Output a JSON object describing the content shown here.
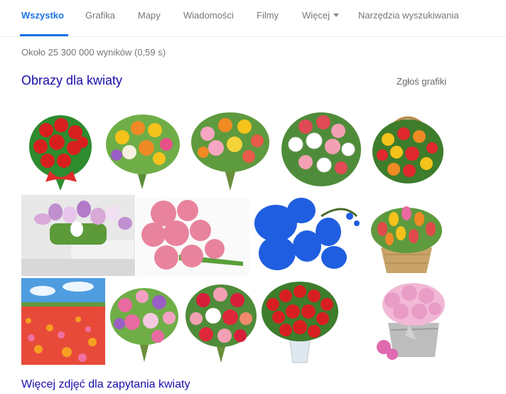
{
  "tabs": [
    {
      "label": "Wszystko",
      "active": true
    },
    {
      "label": "Grafika"
    },
    {
      "label": "Mapy"
    },
    {
      "label": "Wiadomości"
    },
    {
      "label": "Filmy"
    },
    {
      "label": "Więcej",
      "dropdown": true
    },
    {
      "label": "Narzędzia wyszukiwania"
    }
  ],
  "results": {
    "stats": "Około 25 300 000 wyników (0,59 s)",
    "images_heading": "Obrazy dla kwiaty",
    "report_label": "Zgłoś grafiki",
    "more_images_link": "Więcej zdjęć dla zapytania kwiaty"
  },
  "colors": {
    "accent": "#1a73e8",
    "link": "#1a0dab",
    "muted": "#777777"
  }
}
